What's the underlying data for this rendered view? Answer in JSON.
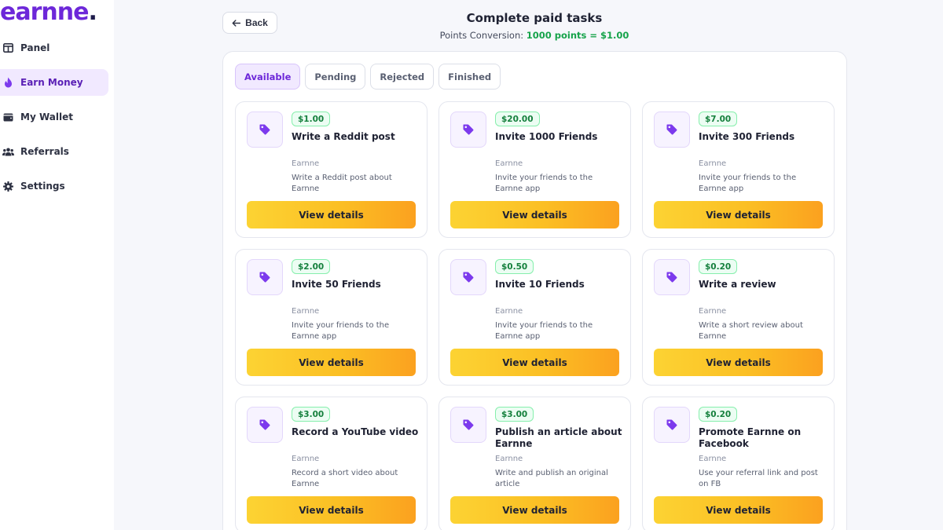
{
  "brand": {
    "name": "earnne",
    "dot": "."
  },
  "sidebar": {
    "items": [
      {
        "label": "Panel",
        "icon": "panel-icon"
      },
      {
        "label": "Earn Money",
        "icon": "flame-icon"
      },
      {
        "label": "My Wallet",
        "icon": "wallet-icon"
      },
      {
        "label": "Referrals",
        "icon": "users-icon"
      },
      {
        "label": "Settings",
        "icon": "gear-icon"
      }
    ],
    "active": "Earn Money"
  },
  "header": {
    "back_label": "Back",
    "title": "Complete paid tasks",
    "conversion_label": "Points Conversion:",
    "conversion_rate": "1000 points = $1.00"
  },
  "tabs": [
    {
      "label": "Available"
    },
    {
      "label": "Pending"
    },
    {
      "label": "Rejected"
    },
    {
      "label": "Finished"
    }
  ],
  "active_tab": "Available",
  "tasks": [
    {
      "reward": "$1.00",
      "title": "Write a Reddit post",
      "brand": "Earnne",
      "description": "Write a Reddit post about Earnne",
      "button": "View details"
    },
    {
      "reward": "$20.00",
      "title": "Invite 1000 Friends",
      "brand": "Earnne",
      "description": "Invite your friends to the Earnne app",
      "button": "View details"
    },
    {
      "reward": "$7.00",
      "title": "Invite 300 Friends",
      "brand": "Earnne",
      "description": "Invite your friends to the Earnne app",
      "button": "View details"
    },
    {
      "reward": "$2.00",
      "title": "Invite 50 Friends",
      "brand": "Earnne",
      "description": "Invite your friends to the Earnne app",
      "button": "View details"
    },
    {
      "reward": "$0.50",
      "title": "Invite 10 Friends",
      "brand": "Earnne",
      "description": "Invite your friends to the Earnne app",
      "button": "View details"
    },
    {
      "reward": "$0.20",
      "title": "Write a review",
      "brand": "Earnne",
      "description": "Write a short review about Earnne",
      "button": "View details"
    },
    {
      "reward": "$3.00",
      "title": "Record a YouTube video",
      "brand": "Earnne",
      "description": "Record a short video about Earnne",
      "button": "View details"
    },
    {
      "reward": "$3.00",
      "title": "Publish an article about Earnne",
      "brand": "Earnne",
      "description": "Write and publish an original article",
      "button": "View details"
    },
    {
      "reward": "$0.20",
      "title": "Promote Earnne on Facebook",
      "brand": "Earnne",
      "description": "Use your referral link and post on FB",
      "button": "View details"
    }
  ],
  "colors": {
    "accent": "#6d28d9",
    "reward_green": "#16a34a",
    "button_yellow": "#fbbf24"
  }
}
